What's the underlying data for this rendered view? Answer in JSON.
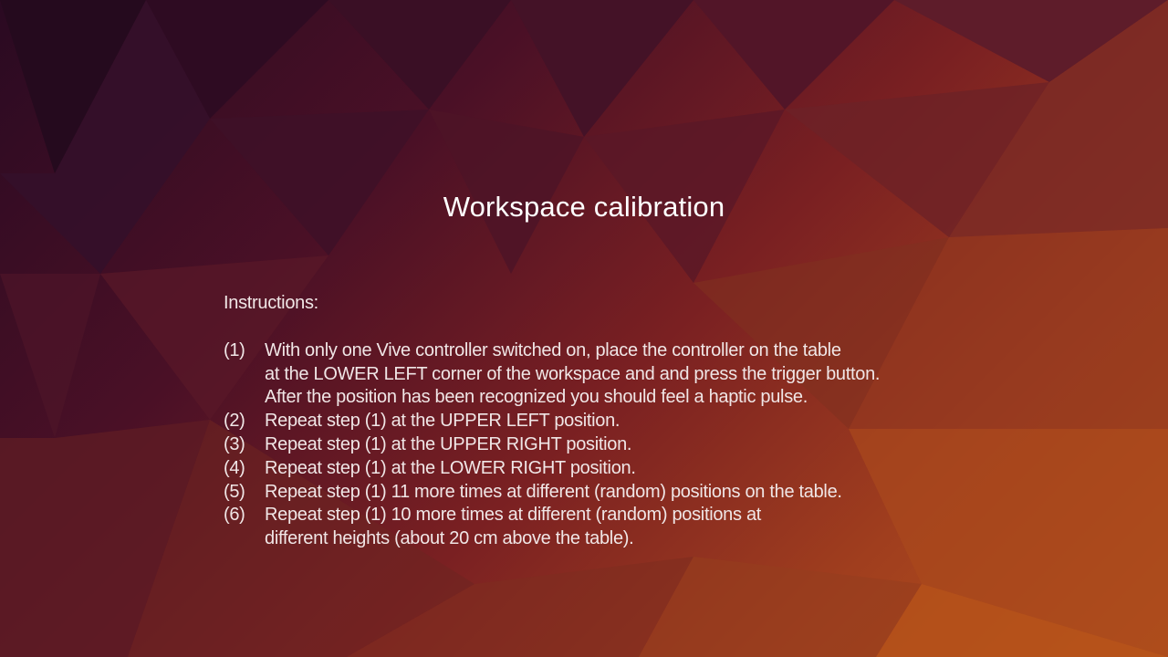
{
  "colors": {
    "background_dark": "#2a0a22",
    "background_mid": "#7a2022",
    "background_light": "#b8561a",
    "text": "#ffffff"
  },
  "title": "Workspace calibration",
  "instructions": {
    "heading": "Instructions:",
    "steps": [
      {
        "number": "(1)",
        "lines": [
          "With only one Vive controller switched on, place the controller on the table",
          "at the LOWER LEFT corner of the workspace and and press the trigger button.",
          "After the position has been recognized you should feel a haptic pulse."
        ]
      },
      {
        "number": "(2)",
        "lines": [
          "Repeat step (1) at the UPPER LEFT position."
        ]
      },
      {
        "number": "(3)",
        "lines": [
          "Repeat step (1) at the UPPER RIGHT position."
        ]
      },
      {
        "number": "(4)",
        "lines": [
          "Repeat step (1) at the LOWER RIGHT position."
        ]
      },
      {
        "number": "(5)",
        "lines": [
          "Repeat step (1) 11 more times at different (random) positions on the table."
        ]
      },
      {
        "number": "(6)",
        "lines": [
          "Repeat step (1) 10 more times at different (random) positions at",
          "different heights (about 20 cm above the table)."
        ]
      }
    ]
  }
}
